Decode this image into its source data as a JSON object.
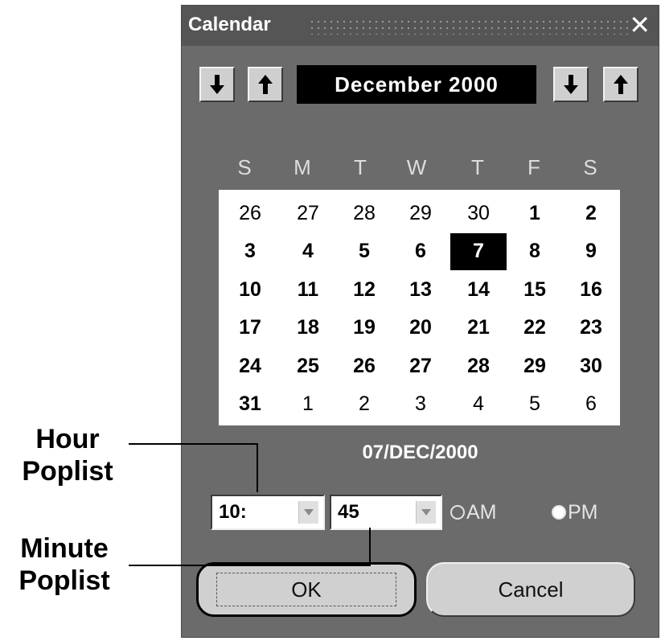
{
  "window": {
    "title": "Calendar",
    "close_icon": "close-icon"
  },
  "navigation": {
    "month_year": "December 2000",
    "month_prev_icon": "arrow-down-icon",
    "month_next_icon": "arrow-up-icon",
    "year_prev_icon": "arrow-down-icon",
    "year_next_icon": "arrow-up-icon"
  },
  "weekdays": [
    "S",
    "M",
    "T",
    "W",
    "T",
    "F",
    "S"
  ],
  "weeks": [
    [
      {
        "d": "26",
        "in": false
      },
      {
        "d": "27",
        "in": false
      },
      {
        "d": "28",
        "in": false
      },
      {
        "d": "29",
        "in": false
      },
      {
        "d": "30",
        "in": false
      },
      {
        "d": "1",
        "in": true
      },
      {
        "d": "2",
        "in": true
      }
    ],
    [
      {
        "d": "3",
        "in": true
      },
      {
        "d": "4",
        "in": true
      },
      {
        "d": "5",
        "in": true
      },
      {
        "d": "6",
        "in": true
      },
      {
        "d": "7",
        "in": true,
        "selected": true
      },
      {
        "d": "8",
        "in": true
      },
      {
        "d": "9",
        "in": true
      }
    ],
    [
      {
        "d": "10",
        "in": true
      },
      {
        "d": "11",
        "in": true
      },
      {
        "d": "12",
        "in": true
      },
      {
        "d": "13",
        "in": true
      },
      {
        "d": "14",
        "in": true
      },
      {
        "d": "15",
        "in": true
      },
      {
        "d": "16",
        "in": true
      }
    ],
    [
      {
        "d": "17",
        "in": true
      },
      {
        "d": "18",
        "in": true
      },
      {
        "d": "19",
        "in": true
      },
      {
        "d": "20",
        "in": true
      },
      {
        "d": "21",
        "in": true
      },
      {
        "d": "22",
        "in": true
      },
      {
        "d": "23",
        "in": true
      }
    ],
    [
      {
        "d": "24",
        "in": true
      },
      {
        "d": "25",
        "in": true
      },
      {
        "d": "26",
        "in": true
      },
      {
        "d": "27",
        "in": true
      },
      {
        "d": "28",
        "in": true
      },
      {
        "d": "29",
        "in": true
      },
      {
        "d": "30",
        "in": true
      }
    ],
    [
      {
        "d": "31",
        "in": true
      },
      {
        "d": "1",
        "in": false
      },
      {
        "d": "2",
        "in": false
      },
      {
        "d": "3",
        "in": false
      },
      {
        "d": "4",
        "in": false
      },
      {
        "d": "5",
        "in": false
      },
      {
        "d": "6",
        "in": false
      }
    ]
  ],
  "selected_date": "07/DEC/2000",
  "time": {
    "hour_value": "10:",
    "minute_value": "45",
    "am_label": "AM",
    "pm_label": "PM",
    "am_checked": true
  },
  "buttons": {
    "ok_label": "OK",
    "cancel_label": "Cancel"
  },
  "callouts": {
    "hour_line1": "Hour",
    "hour_line2": "Poplist",
    "minute_line1": "Minute",
    "minute_line2": "Poplist"
  },
  "colors": {
    "dialog_bg": "#6b6b6b",
    "header_bg": "#000000",
    "button_bg": "#d0d0d0",
    "grid_bg": "#ffffff"
  }
}
